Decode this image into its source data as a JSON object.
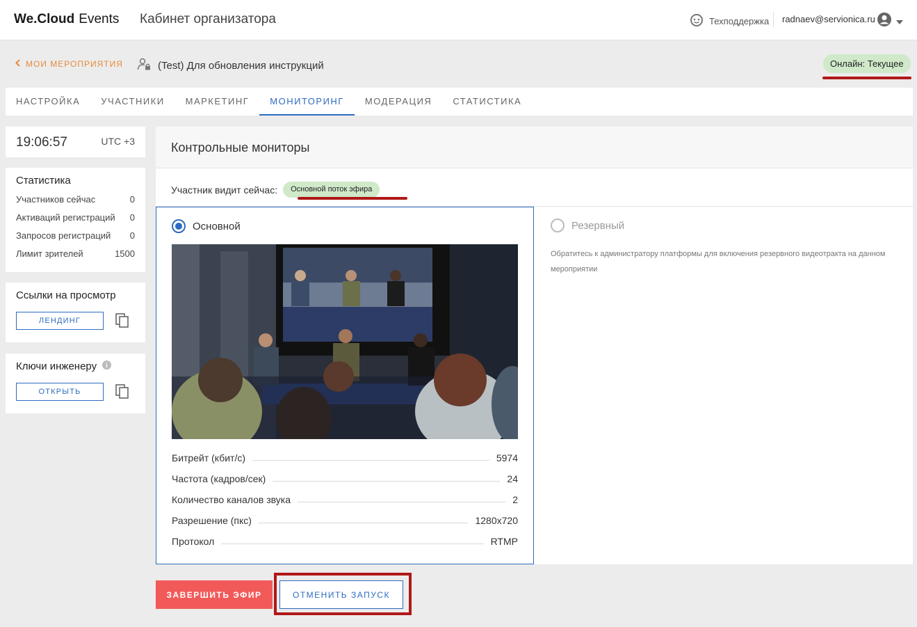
{
  "header": {
    "logo_brand": "We.Cloud",
    "logo_product": "Events",
    "cabinet_title": "Кабинет организатора",
    "support_label": "Техподдержка",
    "user_email": "radnaev@servionica.ru"
  },
  "breadcrumb": {
    "back_label": "МОИ МЕРОПРИЯТИЯ",
    "event_title": "(Test) Для обновления инструкций",
    "status_badge": "Онлайн: Текущее"
  },
  "tabs": [
    {
      "label": "НАСТРОЙКА",
      "active": false
    },
    {
      "label": "УЧАСТНИКИ",
      "active": false
    },
    {
      "label": "МАРКЕТИНГ",
      "active": false
    },
    {
      "label": "МОНИТОРИНГ",
      "active": true
    },
    {
      "label": "МОДЕРАЦИЯ",
      "active": false
    },
    {
      "label": "СТАТИСТИКА",
      "active": false
    }
  ],
  "clock": {
    "time": "19:06:57",
    "timezone": "UTC +3"
  },
  "statistics": {
    "title": "Статистика",
    "rows": [
      {
        "label": "Участников сейчас",
        "value": "0"
      },
      {
        "label": "Активаций регистраций",
        "value": "0"
      },
      {
        "label": "Запросов регистраций",
        "value": "0"
      },
      {
        "label": "Лимит зрителей",
        "value": "1500"
      }
    ]
  },
  "view_links": {
    "title": "Ссылки на просмотр",
    "button_label": "ЛЕНДИНГ"
  },
  "engineer_keys": {
    "title": "Ключи инженеру",
    "button_label": "ОТКРЫТЬ"
  },
  "monitors": {
    "title": "Контрольные мониторы",
    "viewer_sees_label": "Участник видит сейчас:",
    "viewer_sees_value": "Основной поток эфира",
    "primary_label": "Основной",
    "reserve_label": "Резервный",
    "reserve_note": "Обратитесь к администратору платформы для включения резервного видеотракта на данном мероприятии",
    "params": [
      {
        "label": "Битрейт (кбит/с)",
        "value": "5974"
      },
      {
        "label": "Частота (кадров/сек)",
        "value": "24"
      },
      {
        "label": "Количество каналов звука",
        "value": "2"
      },
      {
        "label": "Разрешение (пкс)",
        "value": "1280x720"
      },
      {
        "label": "Протокол",
        "value": "RTMP"
      }
    ]
  },
  "actions": {
    "end_broadcast": "ЗАВЕРШИТЬ ЭФИР",
    "cancel_launch": "ОТМЕНИТЬ ЗАПУСК"
  },
  "colors": {
    "accent": "#2e6bc1",
    "back_link": "#e88a3a",
    "badge_green": "#cfe9c9",
    "danger": "#f25a5a",
    "annotation_red": "#b01818"
  }
}
